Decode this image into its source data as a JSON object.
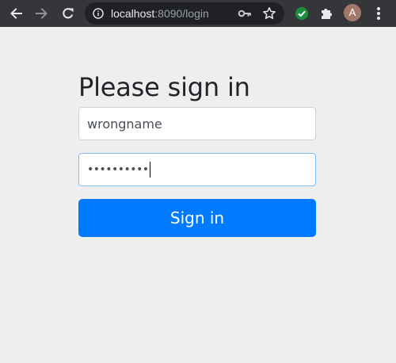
{
  "browser": {
    "url_host": "localhost",
    "url_path": ":8090/login",
    "profile_initial": "A",
    "icons": {
      "back": "back-arrow-icon",
      "forward": "forward-arrow-icon",
      "reload": "reload-icon",
      "site_info": "info-icon",
      "password_key": "key-icon",
      "bookmark": "star-icon",
      "extension_check": "check-circle-icon",
      "extensions": "puzzle-icon",
      "menu": "kebab-menu-icon"
    },
    "colors": {
      "toolbar_bg": "#35363a",
      "omnibox_bg": "#202124",
      "extension_green": "#1e8e3e",
      "avatar_bg": "#a2786a"
    }
  },
  "page": {
    "heading": "Please sign in",
    "username_value": "wrongname",
    "password_value": "••••••••••",
    "submit_label": "Sign in",
    "colors": {
      "background": "#eeeeee",
      "primary": "#007bff",
      "focus_border": "#80bdff"
    }
  }
}
